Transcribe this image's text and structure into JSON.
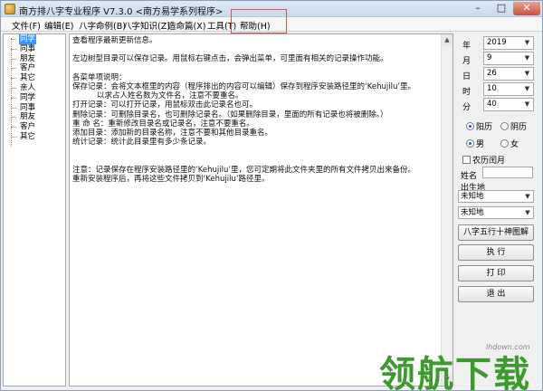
{
  "window": {
    "title": "南方排八字专业程序 V7.3.0  <南方易学系列程序>",
    "controls": {
      "minimize": "–",
      "maximize": "□",
      "close": "✕"
    }
  },
  "menu": [
    "文件(F)",
    "编辑(E)",
    "八字命例(B)",
    "八字知识(Z)",
    "造命篇(X)",
    "工具(T)",
    "帮助(H)"
  ],
  "tree": {
    "items": [
      {
        "label": "同学",
        "selected": true
      },
      {
        "label": "同事"
      },
      {
        "label": "朋友"
      },
      {
        "label": "客户"
      },
      {
        "label": "其它"
      },
      {
        "label": "亲人"
      },
      {
        "label": "同学"
      },
      {
        "label": "同事"
      },
      {
        "label": "朋友"
      },
      {
        "label": "客户"
      },
      {
        "label": "其它"
      }
    ]
  },
  "editor": {
    "lines": [
      "查看程序最新更新信息。",
      "",
      "左边树型目录可以保存记录。用鼠标右键点击，会弹出菜单，可里面有相关的记录操作功能。",
      "",
      "各菜单项说明：",
      "保存记录：会将文本框里的内容（程序排出的内容可以编辑）保存到程序安装路径里的‘Kehujilu’里。",
      "          以求占人姓名数为文件名，注意不要重名。",
      "打开记录：可以打开记录，用鼠标双击此记录名也可。",
      "删除记录：可删除目录名，也可删除记录名。（如果删除目录，里面的所有记录也将被删除。）",
      "重 命 名：重新修改目录名或记录名，注意不要重名。",
      "添加目录：添加新的目录名称，注意不要和其他目录重名。",
      "统计记录：统计此目录里有多少条记录。",
      "",
      "",
      "注意：记录保存在程序安装路径里的‘Kehujilu’里，您可定期将此文件夹里的所有文件拷贝出来备份。",
      "重新安装程序后，再将这些文件拷贝到‘Kehujilu’路径里。"
    ]
  },
  "panel": {
    "date": [
      {
        "label": "年",
        "value": "2019"
      },
      {
        "label": "月",
        "value": "9"
      },
      {
        "label": "日",
        "value": "26"
      },
      {
        "label": "时",
        "value": "10"
      },
      {
        "label": "分",
        "value": "40"
      }
    ],
    "calendar": {
      "solar": "阳历",
      "lunar": "阴历",
      "selected": "solar"
    },
    "gender": {
      "male": "男",
      "female": "女",
      "selected": "male"
    },
    "leap_month": "农历闰月",
    "name_label": "姓名",
    "name_value": "",
    "birthplace_label": "出生地",
    "birthplace_1": "未知地",
    "birthplace_2": "未知地",
    "buttons": {
      "chart": "八字五行十神图解",
      "execute": "执  行",
      "print": "打  印",
      "exit": "退  出"
    }
  },
  "watermark": {
    "text": "领航下载",
    "url": "lhdown.com"
  },
  "colors": {
    "selection": "#3399ff",
    "highlight_box": "#e05050",
    "watermark": "#3d9a2e"
  }
}
